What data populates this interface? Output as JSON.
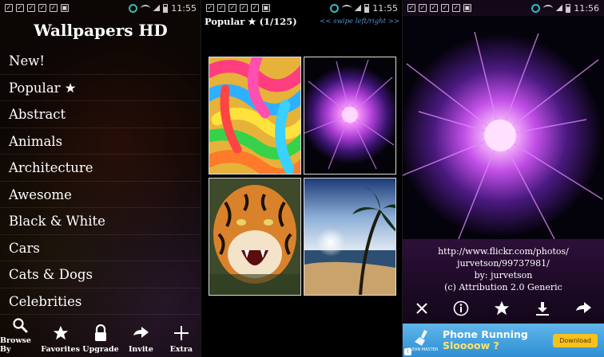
{
  "panel1": {
    "status": {
      "time": "11:55",
      "battery": ""
    },
    "app_title": "Wallpapers HD",
    "categories": [
      "New!",
      "Popular ★",
      "Abstract",
      "Animals",
      "Architecture",
      "Awesome",
      "Black & White",
      "Cars",
      "Cats & Dogs",
      "Celebrities"
    ],
    "nav": [
      {
        "label": "Browse By",
        "icon": "search-icon"
      },
      {
        "label": "Favorites",
        "icon": "star-icon"
      },
      {
        "label": "Upgrade",
        "icon": "lock-icon"
      },
      {
        "label": "Invite",
        "icon": "share-arrow-icon"
      },
      {
        "label": "Extra",
        "icon": "plus-icon"
      }
    ]
  },
  "panel2": {
    "status": {
      "time": "11:55"
    },
    "title": "Popular ★ (1/125)",
    "hint": "<< swipe left/right >>",
    "thumbnails": [
      {
        "name": "candy-worms"
      },
      {
        "name": "plasma-ball"
      },
      {
        "name": "tiger"
      },
      {
        "name": "beach-sunset"
      }
    ]
  },
  "panel3": {
    "status": {
      "time": "11:56"
    },
    "credit": {
      "line1": "http://www.flickr.com/photos/",
      "line2": "jurvetson/99737981/",
      "line3": "by: jurvetson",
      "line4": "(c) Attribution 2.0 Generic"
    },
    "actions": [
      "close-icon",
      "info-icon",
      "star-icon",
      "download-icon",
      "share-arrow-icon"
    ],
    "ad": {
      "brand": "CLEAN MASTER",
      "line1": "Phone Running",
      "line2": "Sloooow ?",
      "button": "Download",
      "badge": "i"
    }
  },
  "colors": {
    "accent_link": "#5a8fd0",
    "ad_bg": "#2f8fd2",
    "ad_button": "#f6c21c"
  }
}
